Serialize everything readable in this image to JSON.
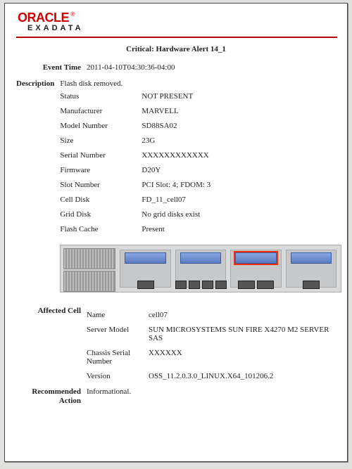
{
  "logo": {
    "brand": "ORACLE",
    "reg": "®",
    "product": "EXADATA"
  },
  "title": "Critical: Hardware Alert 14_1",
  "labels": {
    "event_time": "Event Time",
    "description": "Description",
    "affected_cell": "Affected Cell",
    "recommended_action": "Recommended\nAction"
  },
  "event_time": "2011-04-10T04:30:36-04:00",
  "description_line": "Flash disk removed.",
  "details": [
    {
      "k": "Status",
      "v": "NOT PRESENT"
    },
    {
      "k": "Manufacturer",
      "v": "MARVELL"
    },
    {
      "k": "Model Number",
      "v": "SD88SA02"
    },
    {
      "k": "Size",
      "v": "23G"
    },
    {
      "k": "Serial Number",
      "v": "XXXXXXXXXXXX"
    },
    {
      "k": "Firmware",
      "v": "D20Y"
    },
    {
      "k": "Slot Number",
      "v": "PCI Slot: 4; FDOM: 3"
    },
    {
      "k": "Cell Disk",
      "v": "FD_11_cell07"
    },
    {
      "k": "Grid Disk",
      "v": "No grid disks exist"
    },
    {
      "k": "Flash Cache",
      "v": "Present"
    }
  ],
  "affected_cell": [
    {
      "k": "Name",
      "v": "cell07"
    },
    {
      "k": "Server Model",
      "v": "SUN MICROSYSTEMS SUN FIRE X4270 M2 SERVER SAS"
    },
    {
      "k": "Chassis Serial Number",
      "v": "XXXXXX"
    },
    {
      "k": "Version",
      "v": "OSS_11.2.0.3.0_LINUX.X64_101206.2"
    }
  ],
  "recommended_action": "Informational.",
  "server_image": {
    "psu_count": 2,
    "pcie_slots": 4,
    "highlighted_slot_index": 2
  }
}
